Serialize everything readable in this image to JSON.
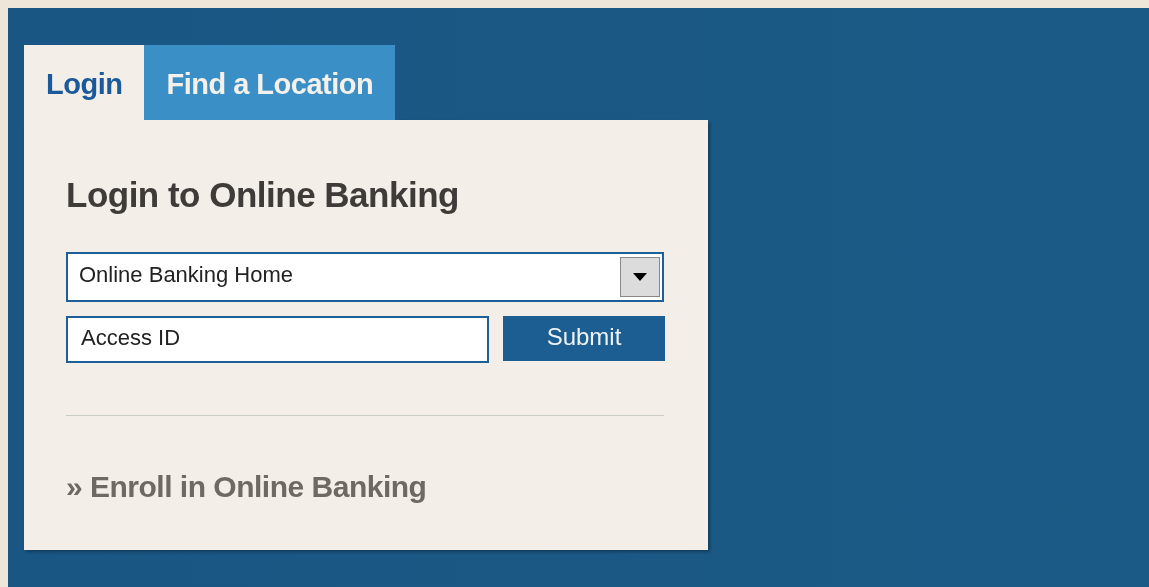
{
  "tabs": [
    {
      "label": "Login",
      "selected": true
    },
    {
      "label": "Find a Location",
      "selected": false
    }
  ],
  "panel": {
    "heading": "Login to Online Banking",
    "destination_select": {
      "value": "Online Banking Home"
    },
    "access_field": {
      "value": "Access ID"
    },
    "submit_button": "Submit",
    "enroll_link": "» Enroll in Online Banking"
  }
}
